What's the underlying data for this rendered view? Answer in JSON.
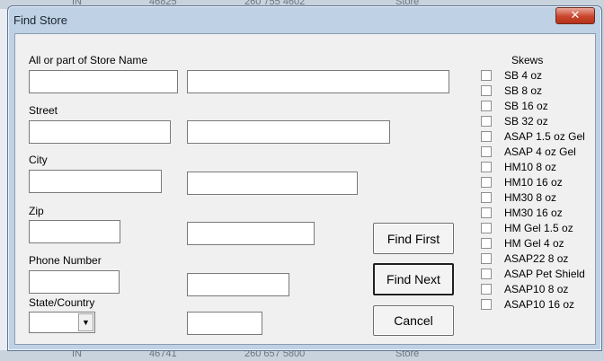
{
  "window": {
    "title": "Find Store",
    "close_glyph": "✕"
  },
  "fields": {
    "store_name_label": "All or part of Store Name",
    "street_label": "Street",
    "city_label": "City",
    "zip_label": "Zip",
    "phone_label": "Phone Number",
    "state_label": "State/Country"
  },
  "buttons": {
    "find_first": "Find First",
    "find_next": "Find Next",
    "cancel": "Cancel"
  },
  "skews": {
    "title": "Skews",
    "items": [
      "SB 4 oz",
      "SB 8 oz",
      "SB 16 oz",
      "SB 32 oz",
      "ASAP 1.5 oz Gel",
      "ASAP 4 oz Gel",
      "HM10 8 oz",
      "HM10 16 oz",
      "HM30 8 oz",
      "HM30 16 oz",
      "HM Gel 1.5 oz",
      "HM Gel 4 oz",
      "ASAP22 8 oz",
      "ASAP Pet Shield",
      "ASAP10 8 oz",
      "ASAP10 16 oz"
    ]
  },
  "background": {
    "top_row": [
      "IN",
      "46825",
      "260 755 4602",
      "Store"
    ],
    "bottom_row": [
      "IN",
      "46741",
      "260 657 5800",
      "Store"
    ]
  },
  "colors": {
    "frame": "#bfd1e5",
    "close": "#c9452c",
    "client": "#f0f0f0"
  },
  "icons": {
    "close": "close-icon",
    "dropdown": "chevron-down-icon"
  }
}
